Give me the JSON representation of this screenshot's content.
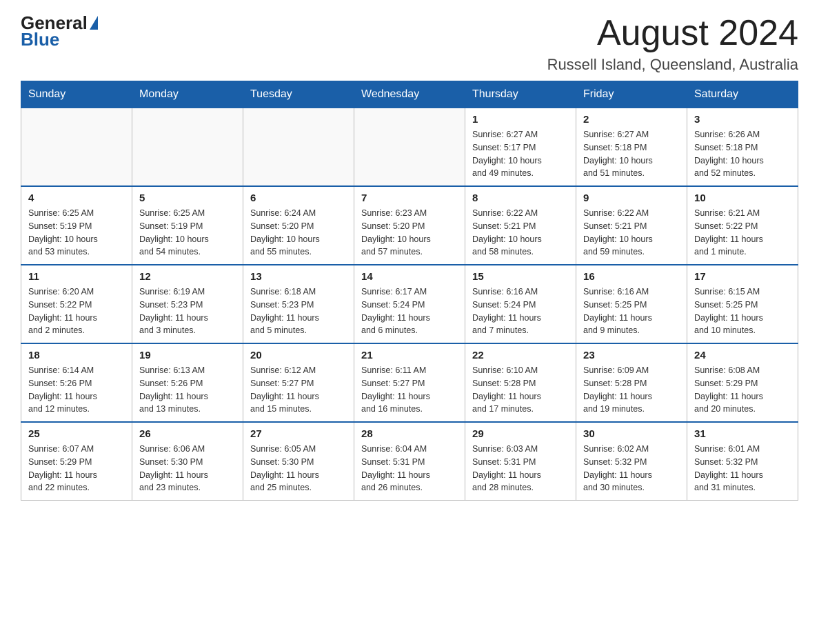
{
  "logo": {
    "text_general": "General",
    "text_blue": "Blue"
  },
  "header": {
    "month_year": "August 2024",
    "location": "Russell Island, Queensland, Australia"
  },
  "days_of_week": [
    "Sunday",
    "Monday",
    "Tuesday",
    "Wednesday",
    "Thursday",
    "Friday",
    "Saturday"
  ],
  "weeks": [
    {
      "days": [
        {
          "num": "",
          "info": ""
        },
        {
          "num": "",
          "info": ""
        },
        {
          "num": "",
          "info": ""
        },
        {
          "num": "",
          "info": ""
        },
        {
          "num": "1",
          "info": "Sunrise: 6:27 AM\nSunset: 5:17 PM\nDaylight: 10 hours\nand 49 minutes."
        },
        {
          "num": "2",
          "info": "Sunrise: 6:27 AM\nSunset: 5:18 PM\nDaylight: 10 hours\nand 51 minutes."
        },
        {
          "num": "3",
          "info": "Sunrise: 6:26 AM\nSunset: 5:18 PM\nDaylight: 10 hours\nand 52 minutes."
        }
      ]
    },
    {
      "days": [
        {
          "num": "4",
          "info": "Sunrise: 6:25 AM\nSunset: 5:19 PM\nDaylight: 10 hours\nand 53 minutes."
        },
        {
          "num": "5",
          "info": "Sunrise: 6:25 AM\nSunset: 5:19 PM\nDaylight: 10 hours\nand 54 minutes."
        },
        {
          "num": "6",
          "info": "Sunrise: 6:24 AM\nSunset: 5:20 PM\nDaylight: 10 hours\nand 55 minutes."
        },
        {
          "num": "7",
          "info": "Sunrise: 6:23 AM\nSunset: 5:20 PM\nDaylight: 10 hours\nand 57 minutes."
        },
        {
          "num": "8",
          "info": "Sunrise: 6:22 AM\nSunset: 5:21 PM\nDaylight: 10 hours\nand 58 minutes."
        },
        {
          "num": "9",
          "info": "Sunrise: 6:22 AM\nSunset: 5:21 PM\nDaylight: 10 hours\nand 59 minutes."
        },
        {
          "num": "10",
          "info": "Sunrise: 6:21 AM\nSunset: 5:22 PM\nDaylight: 11 hours\nand 1 minute."
        }
      ]
    },
    {
      "days": [
        {
          "num": "11",
          "info": "Sunrise: 6:20 AM\nSunset: 5:22 PM\nDaylight: 11 hours\nand 2 minutes."
        },
        {
          "num": "12",
          "info": "Sunrise: 6:19 AM\nSunset: 5:23 PM\nDaylight: 11 hours\nand 3 minutes."
        },
        {
          "num": "13",
          "info": "Sunrise: 6:18 AM\nSunset: 5:23 PM\nDaylight: 11 hours\nand 5 minutes."
        },
        {
          "num": "14",
          "info": "Sunrise: 6:17 AM\nSunset: 5:24 PM\nDaylight: 11 hours\nand 6 minutes."
        },
        {
          "num": "15",
          "info": "Sunrise: 6:16 AM\nSunset: 5:24 PM\nDaylight: 11 hours\nand 7 minutes."
        },
        {
          "num": "16",
          "info": "Sunrise: 6:16 AM\nSunset: 5:25 PM\nDaylight: 11 hours\nand 9 minutes."
        },
        {
          "num": "17",
          "info": "Sunrise: 6:15 AM\nSunset: 5:25 PM\nDaylight: 11 hours\nand 10 minutes."
        }
      ]
    },
    {
      "days": [
        {
          "num": "18",
          "info": "Sunrise: 6:14 AM\nSunset: 5:26 PM\nDaylight: 11 hours\nand 12 minutes."
        },
        {
          "num": "19",
          "info": "Sunrise: 6:13 AM\nSunset: 5:26 PM\nDaylight: 11 hours\nand 13 minutes."
        },
        {
          "num": "20",
          "info": "Sunrise: 6:12 AM\nSunset: 5:27 PM\nDaylight: 11 hours\nand 15 minutes."
        },
        {
          "num": "21",
          "info": "Sunrise: 6:11 AM\nSunset: 5:27 PM\nDaylight: 11 hours\nand 16 minutes."
        },
        {
          "num": "22",
          "info": "Sunrise: 6:10 AM\nSunset: 5:28 PM\nDaylight: 11 hours\nand 17 minutes."
        },
        {
          "num": "23",
          "info": "Sunrise: 6:09 AM\nSunset: 5:28 PM\nDaylight: 11 hours\nand 19 minutes."
        },
        {
          "num": "24",
          "info": "Sunrise: 6:08 AM\nSunset: 5:29 PM\nDaylight: 11 hours\nand 20 minutes."
        }
      ]
    },
    {
      "days": [
        {
          "num": "25",
          "info": "Sunrise: 6:07 AM\nSunset: 5:29 PM\nDaylight: 11 hours\nand 22 minutes."
        },
        {
          "num": "26",
          "info": "Sunrise: 6:06 AM\nSunset: 5:30 PM\nDaylight: 11 hours\nand 23 minutes."
        },
        {
          "num": "27",
          "info": "Sunrise: 6:05 AM\nSunset: 5:30 PM\nDaylight: 11 hours\nand 25 minutes."
        },
        {
          "num": "28",
          "info": "Sunrise: 6:04 AM\nSunset: 5:31 PM\nDaylight: 11 hours\nand 26 minutes."
        },
        {
          "num": "29",
          "info": "Sunrise: 6:03 AM\nSunset: 5:31 PM\nDaylight: 11 hours\nand 28 minutes."
        },
        {
          "num": "30",
          "info": "Sunrise: 6:02 AM\nSunset: 5:32 PM\nDaylight: 11 hours\nand 30 minutes."
        },
        {
          "num": "31",
          "info": "Sunrise: 6:01 AM\nSunset: 5:32 PM\nDaylight: 11 hours\nand 31 minutes."
        }
      ]
    }
  ]
}
